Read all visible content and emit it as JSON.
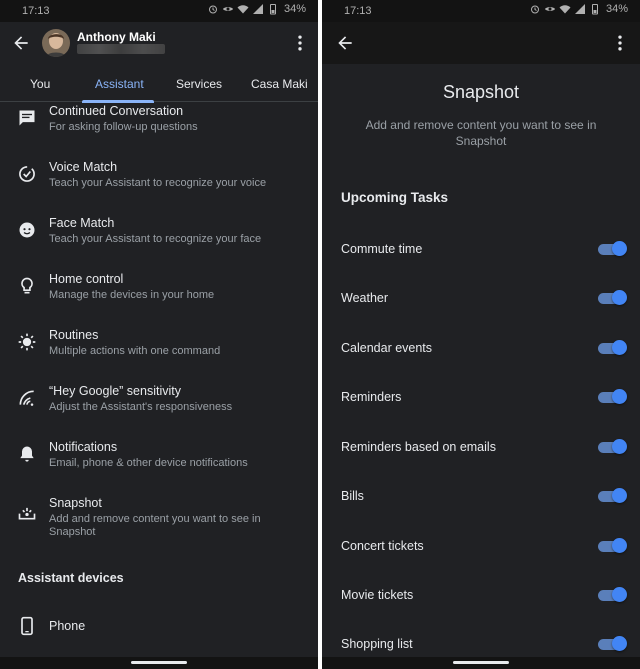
{
  "status_bar": {
    "time": "17:13",
    "battery": "34%"
  },
  "left_screen": {
    "account": {
      "name": "Anthony Maki"
    },
    "tabs": [
      {
        "label": "You",
        "active": false
      },
      {
        "label": "Assistant",
        "active": true
      },
      {
        "label": "Services",
        "active": false
      },
      {
        "label": "Casa Maki",
        "active": false
      }
    ],
    "settings": [
      {
        "icon": "chat-icon",
        "title": "Continued Conversation",
        "subtitle": "For asking follow-up questions"
      },
      {
        "icon": "voice-match-icon",
        "title": "Voice Match",
        "subtitle": "Teach your Assistant to recognize your voice"
      },
      {
        "icon": "face-icon",
        "title": "Face Match",
        "subtitle": "Teach your Assistant to recognize your face"
      },
      {
        "icon": "lightbulb-icon",
        "title": "Home control",
        "subtitle": "Manage the devices in your home"
      },
      {
        "icon": "routines-icon",
        "title": "Routines",
        "subtitle": "Multiple actions with one command"
      },
      {
        "icon": "sensitivity-icon",
        "title": "“Hey Google” sensitivity",
        "subtitle": "Adjust the Assistant's responsiveness"
      },
      {
        "icon": "bell-icon",
        "title": "Notifications",
        "subtitle": "Email, phone & other device notifications"
      },
      {
        "icon": "snapshot-icon",
        "title": "Snapshot",
        "subtitle": "Add and remove content you want to see in Snapshot"
      }
    ],
    "devices_section": {
      "heading": "Assistant devices",
      "items": [
        {
          "icon": "phone-icon",
          "title": "Phone"
        }
      ]
    }
  },
  "right_screen": {
    "title": "Snapshot",
    "subtitle": "Add and remove content you want to see in Snapshot",
    "section": "Upcoming Tasks",
    "toggles": [
      {
        "label": "Commute time",
        "on": true
      },
      {
        "label": "Weather",
        "on": true
      },
      {
        "label": "Calendar events",
        "on": true
      },
      {
        "label": "Reminders",
        "on": true
      },
      {
        "label": "Reminders based on emails",
        "on": true
      },
      {
        "label": "Bills",
        "on": true
      },
      {
        "label": "Concert tickets",
        "on": true
      },
      {
        "label": "Movie tickets",
        "on": true
      },
      {
        "label": "Shopping list",
        "on": true
      }
    ]
  },
  "colors": {
    "background": "#202124",
    "accent": "#8ab4f8",
    "toggle_on": "#4285f4",
    "text_secondary": "#9aa0a6"
  }
}
